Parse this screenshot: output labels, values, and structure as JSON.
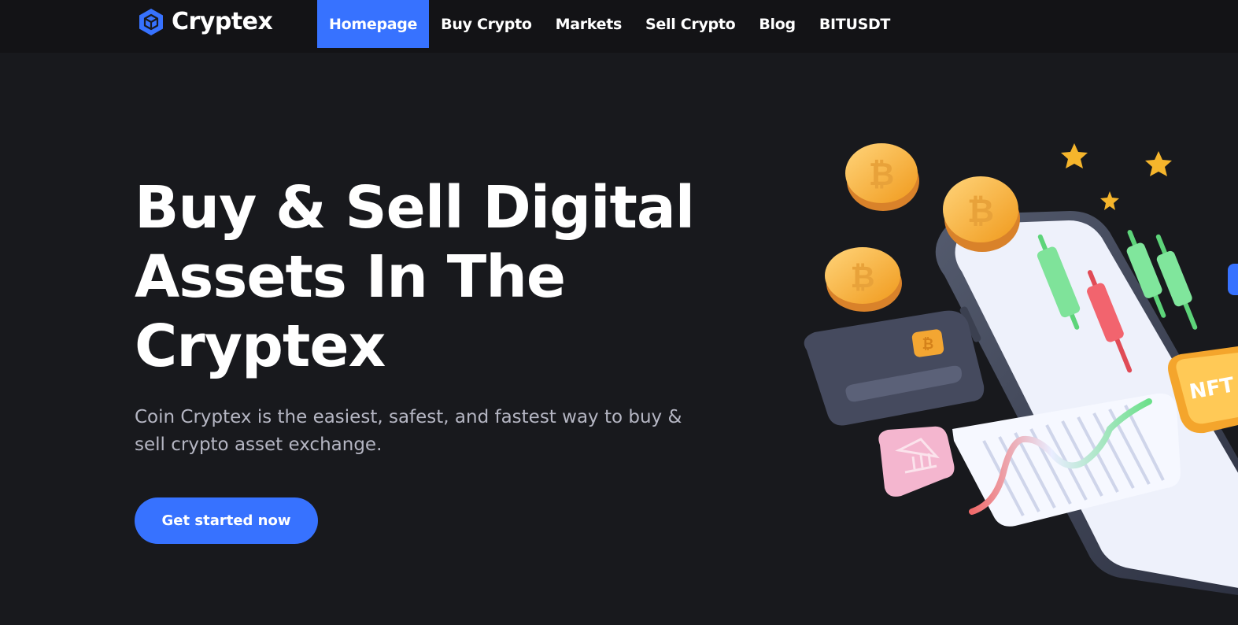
{
  "brand": {
    "name": "Cryptex",
    "logo_icon": "cube-logo-icon",
    "accent": "#3772ff"
  },
  "nav": {
    "items": [
      {
        "label": "Homepage",
        "active": true
      },
      {
        "label": "Buy Crypto",
        "active": false
      },
      {
        "label": "Markets",
        "active": false
      },
      {
        "label": "Sell Crypto",
        "active": false
      },
      {
        "label": "Blog",
        "active": false
      },
      {
        "label": "BITUSDT",
        "active": false
      }
    ]
  },
  "hero": {
    "title_lines": [
      "Buy & Sell Digital",
      "Assets In The",
      "Cryptex"
    ],
    "subtitle": "Coin Cryptex is the easiest, safest, and fastest way to buy & sell crypto asset exchange.",
    "cta_label": "Get started now"
  },
  "illustration": {
    "nft_label": "NFT",
    "coin_symbol": "₿",
    "bank_icon": "bank-icon",
    "elements": [
      "bitcoin-coin-icon",
      "star-icon",
      "phone-icon",
      "credit-card-icon",
      "candlestick-chart",
      "line-chart-card",
      "nft-badge"
    ]
  }
}
